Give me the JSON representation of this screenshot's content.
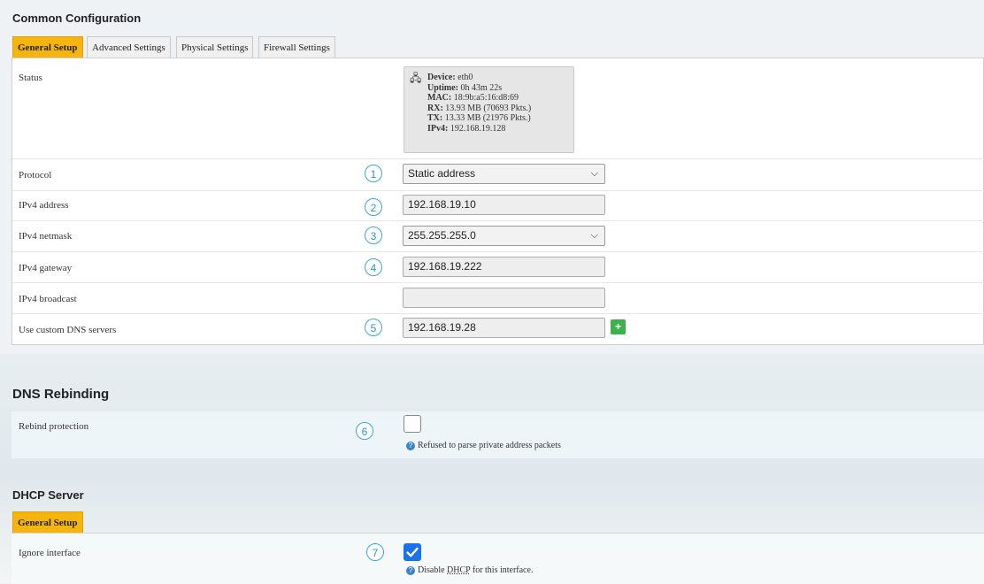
{
  "common": {
    "title": "Common Configuration",
    "tabs": [
      "General Setup",
      "Advanced Settings",
      "Physical Settings",
      "Firewall Settings"
    ]
  },
  "status": {
    "label": "Status",
    "device_label": "Device:",
    "device": "eth0",
    "uptime_label": "Uptime:",
    "uptime": "0h 43m 22s",
    "mac_label": "MAC:",
    "mac": "18:9b:a5:16:d8:69",
    "rx_label": "RX:",
    "rx": "13.93 MB (70693 Pkts.)",
    "tx_label": "TX:",
    "tx": "13.33 MB (21976 Pkts.)",
    "ipv4_label": "IPv4:",
    "ipv4": "192.168.19.128"
  },
  "fields": {
    "protocol": {
      "label": "Protocol",
      "value": "Static address",
      "num": "1"
    },
    "ipv4_address": {
      "label": "IPv4 address",
      "value": "192.168.19.10",
      "num": "2"
    },
    "ipv4_netmask": {
      "label": "IPv4 netmask",
      "value": "255.255.255.0",
      "num": "3"
    },
    "ipv4_gateway": {
      "label": "IPv4 gateway",
      "value": "192.168.19.222",
      "num": "4"
    },
    "ipv4_broadcast": {
      "label": "IPv4 broadcast",
      "value": ""
    },
    "dns": {
      "label": "Use custom DNS servers",
      "value": "192.168.19.28",
      "num": "5",
      "add": "+"
    }
  },
  "dns_rebinding": {
    "title": "DNS Rebinding",
    "label": "Rebind protection",
    "num": "6",
    "help": "Refused to parse private address packets",
    "checked": false
  },
  "dhcp": {
    "title": "DHCP Server",
    "tab": "General Setup",
    "label": "Ignore interface",
    "num": "7",
    "help_pre": "Disable ",
    "help_abbr": "DHCP",
    "help_post": " for this interface.",
    "checked": true
  },
  "colors": {
    "accent": "#f6b40e",
    "check": "#1a73e8",
    "number_ring": "#3aa6e3",
    "add_button": "#3cb34a"
  }
}
